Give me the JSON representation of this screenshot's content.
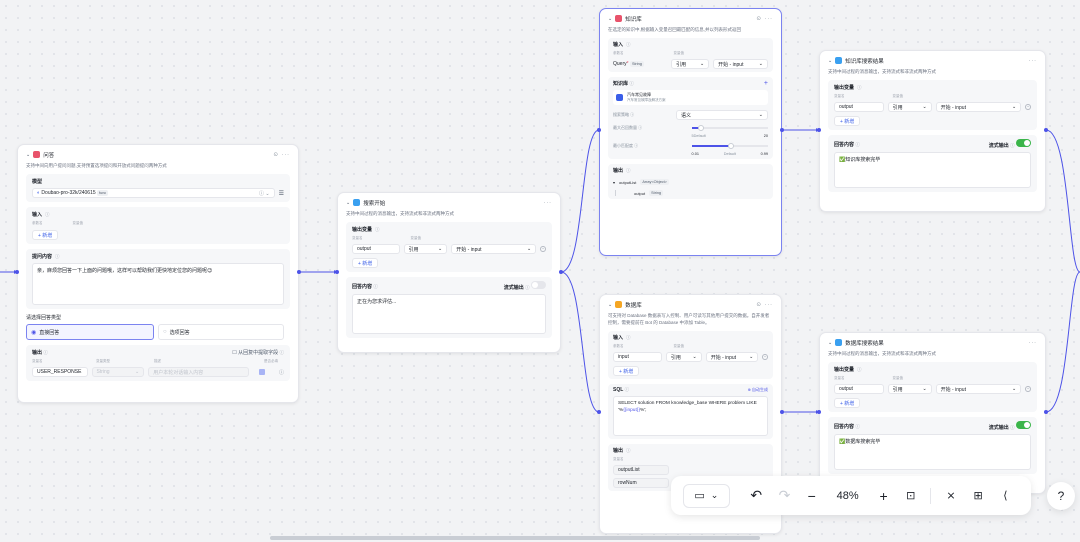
{
  "nodes": {
    "question": {
      "title": "问答",
      "desc": "支持中间向用户提问问题,支持预置选项提问和开放式问题提问两种方式",
      "model_label": "模型",
      "model_value": "Doubao-pro-32k/240615",
      "model_tag": "func",
      "input_label": "输入",
      "col_param": "参数名",
      "col_value": "变量值",
      "add": "+ 新增",
      "question_label": "提问内容",
      "question_text": "亲，麻烦您回答一下上面的问题哦，这样可以帮助我们更快地定位您的问题呢😉",
      "answer_type_label": "请选择回答类型",
      "answer_direct": "直接回答",
      "answer_option": "选项回答",
      "output_label": "输出",
      "extract_label": "从回复中提取字段",
      "out_cols": [
        "变量名",
        "变量类型",
        "描述",
        "是否必填"
      ],
      "out_name": "USER_RESPONSE",
      "out_type": "String",
      "out_desc": "用户本轮对话输入内容"
    },
    "search_start": {
      "title": "搜索开始",
      "desc": "支持中间过程的消息输出，支持流式和非流式两种方式",
      "out_var_label": "输出变量",
      "col_param": "变量名",
      "col_value": "变量值",
      "var_name": "output",
      "ref": "引用",
      "ref_value": "开始 - input",
      "add": "+ 新增",
      "reply_label": "回答内容",
      "stream_label": "流式输出",
      "reply_text": "正在为您求评估..."
    },
    "knowledge": {
      "title": "知识库",
      "desc": "在选定的知识中,根据输入变量召回最匹配的信息,并以列表形式返回",
      "input_label": "输入",
      "col_param": "参数名",
      "col_value": "变量值",
      "query_name": "Query",
      "query_type": "String",
      "ref": "引用",
      "ref_value": "开始 - input",
      "kb_label": "知识库",
      "kb_name": "汽车常见故障",
      "kb_sub": "汽车常见故障及解决方案",
      "search_strategy_label": "搜索策略",
      "search_strategy_value": "语义",
      "max_recall_label": "最大召回数量",
      "max_recall_default": "5Default",
      "max_recall_max": "20",
      "min_match_label": "最小匹配度",
      "min_match_min": "0.01",
      "min_match_default": "Default",
      "min_match_max": "0.99",
      "output_label": "输出",
      "out_list": "outputList",
      "out_list_type": "Array<Object>",
      "out_child": "output",
      "out_child_type": "String"
    },
    "kb_result": {
      "title": "知识库搜索结果",
      "desc": "支持中间过程的消息输出，支持流式和非流式两种方式",
      "out_var_label": "输出变量",
      "col_param": "变量名",
      "col_value": "变量值",
      "var_name": "output",
      "ref": "引用",
      "ref_value": "开始 - input",
      "add": "+ 新增",
      "reply_label": "回答内容",
      "stream_label": "流式输出",
      "reply_text": "✅知识库搜索完毕"
    },
    "database": {
      "title": "数据库",
      "desc": "可支持对 Database 数据表写入控制、用户可读写其他用户提交的数据。自开发者控制，需要提前在 Bot 的 Database 中添加 Table。",
      "input_label": "输入",
      "col_param": "参数名",
      "col_value": "变量值",
      "input_name": "input",
      "ref": "引用",
      "ref_value": "开始 - input",
      "add": "+ 新增",
      "sql_label": "SQL",
      "auto_gen": "自动生成",
      "sql_text_a": "SELECT solution FROM knowledge_base WHERE problem LIKE '%",
      "sql_text_b": "{{input}}",
      "sql_text_c": "%';",
      "output_label": "输出",
      "out_col": "变量名",
      "out1": "outputList",
      "out2": "rowNum"
    },
    "db_result": {
      "title": "数据库搜索结果",
      "desc": "支持中间过程的消息输出，支持流式和非流式两种方式",
      "out_var_label": "输出变量",
      "col_param": "变量名",
      "col_value": "变量值",
      "var_name": "output",
      "ref": "引用",
      "ref_value": "开始 - input",
      "add": "+ 新增",
      "reply_label": "回答内容",
      "stream_label": "流式输出",
      "reply_text": "✅数据库搜索完毕"
    }
  },
  "toolbar": {
    "zoom": "48%"
  },
  "colors": {
    "accent": "#4d53e8",
    "question_icon": "#e8536b",
    "search_icon": "#3aa0f0",
    "db_icon": "#f5a623",
    "toggle_on": "#3bb54a"
  }
}
